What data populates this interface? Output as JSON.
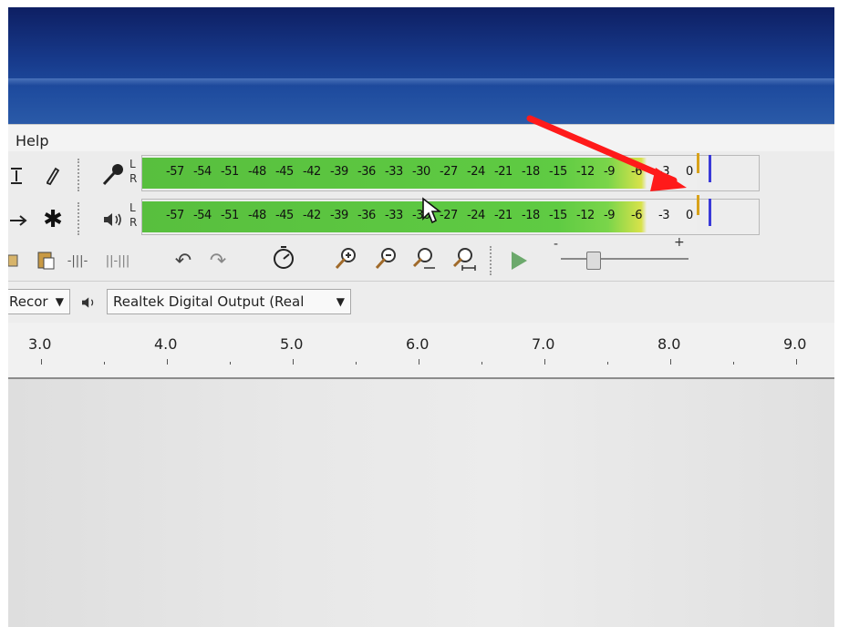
{
  "menu": {
    "help": "Help"
  },
  "meters": {
    "channel_l": "L",
    "channel_r": "R",
    "record_ticks": [
      "-57",
      "-54",
      "-51",
      "-48",
      "-45",
      "-42",
      "-39",
      "-36",
      "-33",
      "-30",
      "-27",
      "-24",
      "-21",
      "-18",
      "-15",
      "-12",
      "-9",
      "-6",
      "-3",
      "0"
    ],
    "playback_ticks": [
      "-57",
      "-54",
      "-51",
      "-48",
      "-45",
      "-42",
      "-39",
      "-36",
      "-33",
      "-30",
      "-27",
      "-24",
      "-21",
      "-18",
      "-15",
      "-12",
      "-9",
      "-6",
      "-3",
      "0"
    ]
  },
  "devices": {
    "input_label": "Recor",
    "output_device": "Realtek Digital Output (Real"
  },
  "ruler": {
    "labels": [
      "3.0",
      "4.0",
      "5.0",
      "6.0",
      "7.0",
      "8.0",
      "9.0"
    ]
  },
  "slider": {
    "minus": "-",
    "plus": "+"
  },
  "colors": {
    "meter_green": "#5fcb43",
    "titlebar_blue": "#173a8b",
    "annotation_red": "#ff1a1a"
  },
  "icons": [
    "pencil-icon",
    "microphone-icon",
    "speaker-icon",
    "undo-icon",
    "redo-icon",
    "zoom-in-icon",
    "zoom-out-icon",
    "play-icon"
  ]
}
